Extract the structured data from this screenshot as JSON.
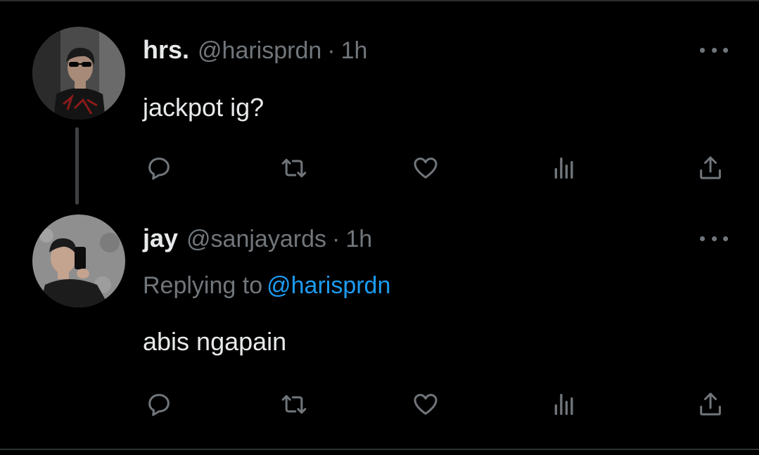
{
  "colors": {
    "background": "#000000",
    "text": "#e7e9ea",
    "muted": "#71767b",
    "link": "#1d9bf0",
    "divider": "#2f3336"
  },
  "tweets": [
    {
      "display_name": "hrs.",
      "handle": "@harisprdn",
      "separator": "·",
      "time": "1h",
      "text": "jackpot ig?",
      "avatar_icon": "avatar-photo-sunglasses",
      "actions": [
        "reply-icon",
        "retweet-icon",
        "like-icon",
        "views-icon",
        "share-icon"
      ]
    },
    {
      "display_name": "jay",
      "handle": "@sanjayards",
      "separator": "·",
      "time": "1h",
      "replying_prefix": "Replying to",
      "replying_to": "@harisprdn",
      "text": "abis ngapain",
      "avatar_icon": "avatar-photo-mirror-selfie",
      "actions": [
        "reply-icon",
        "retweet-icon",
        "like-icon",
        "views-icon",
        "share-icon"
      ]
    }
  ]
}
